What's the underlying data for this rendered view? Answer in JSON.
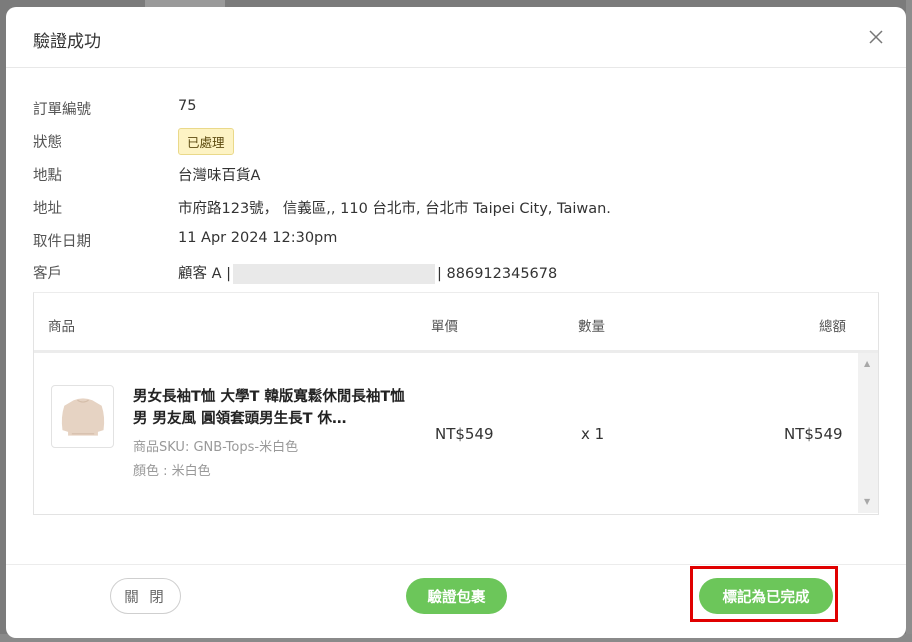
{
  "modal": {
    "title": "驗證成功"
  },
  "info": {
    "order_no_label": "訂單編號",
    "order_no": "75",
    "status_label": "狀態",
    "status": "已處理",
    "location_label": "地點",
    "location": "台灣味百貨A",
    "address_label": "地址",
    "address": "市府路123號， 信義區,, 110 台北市, 台北市 Taipei City, Taiwan.",
    "pickup_date_label": "取件日期",
    "pickup_date": "11 Apr 2024 12:30pm",
    "customer_label": "客戶",
    "customer_name": "顧客 A |",
    "customer_phone": "| 886912345678"
  },
  "table": {
    "headers": {
      "product": "商品",
      "unit_price": "單價",
      "quantity": "數量",
      "total": "總額"
    },
    "rows": [
      {
        "name": "男女長袖T恤 大學T 韓版寬鬆休閒長袖T恤男 男友風 圓領套頭男生長T 休…",
        "sku": "商品SKU: GNB-Tops-米白色",
        "color": "顏色 : 米白色",
        "unit_price": "NT$549",
        "quantity": "x 1",
        "total": "NT$549"
      }
    ]
  },
  "footer": {
    "close_label": "關 閉",
    "verify_label": "驗證包裹",
    "complete_label": "標記為已完成"
  },
  "colors": {
    "primary_green": "#6cc65a",
    "badge_bg": "#fdf3c4",
    "highlight_red": "#e00000"
  },
  "icons": {
    "close": "close-icon",
    "scroll_up": "scroll-up-arrow-icon",
    "scroll_down": "scroll-down-arrow-icon"
  }
}
